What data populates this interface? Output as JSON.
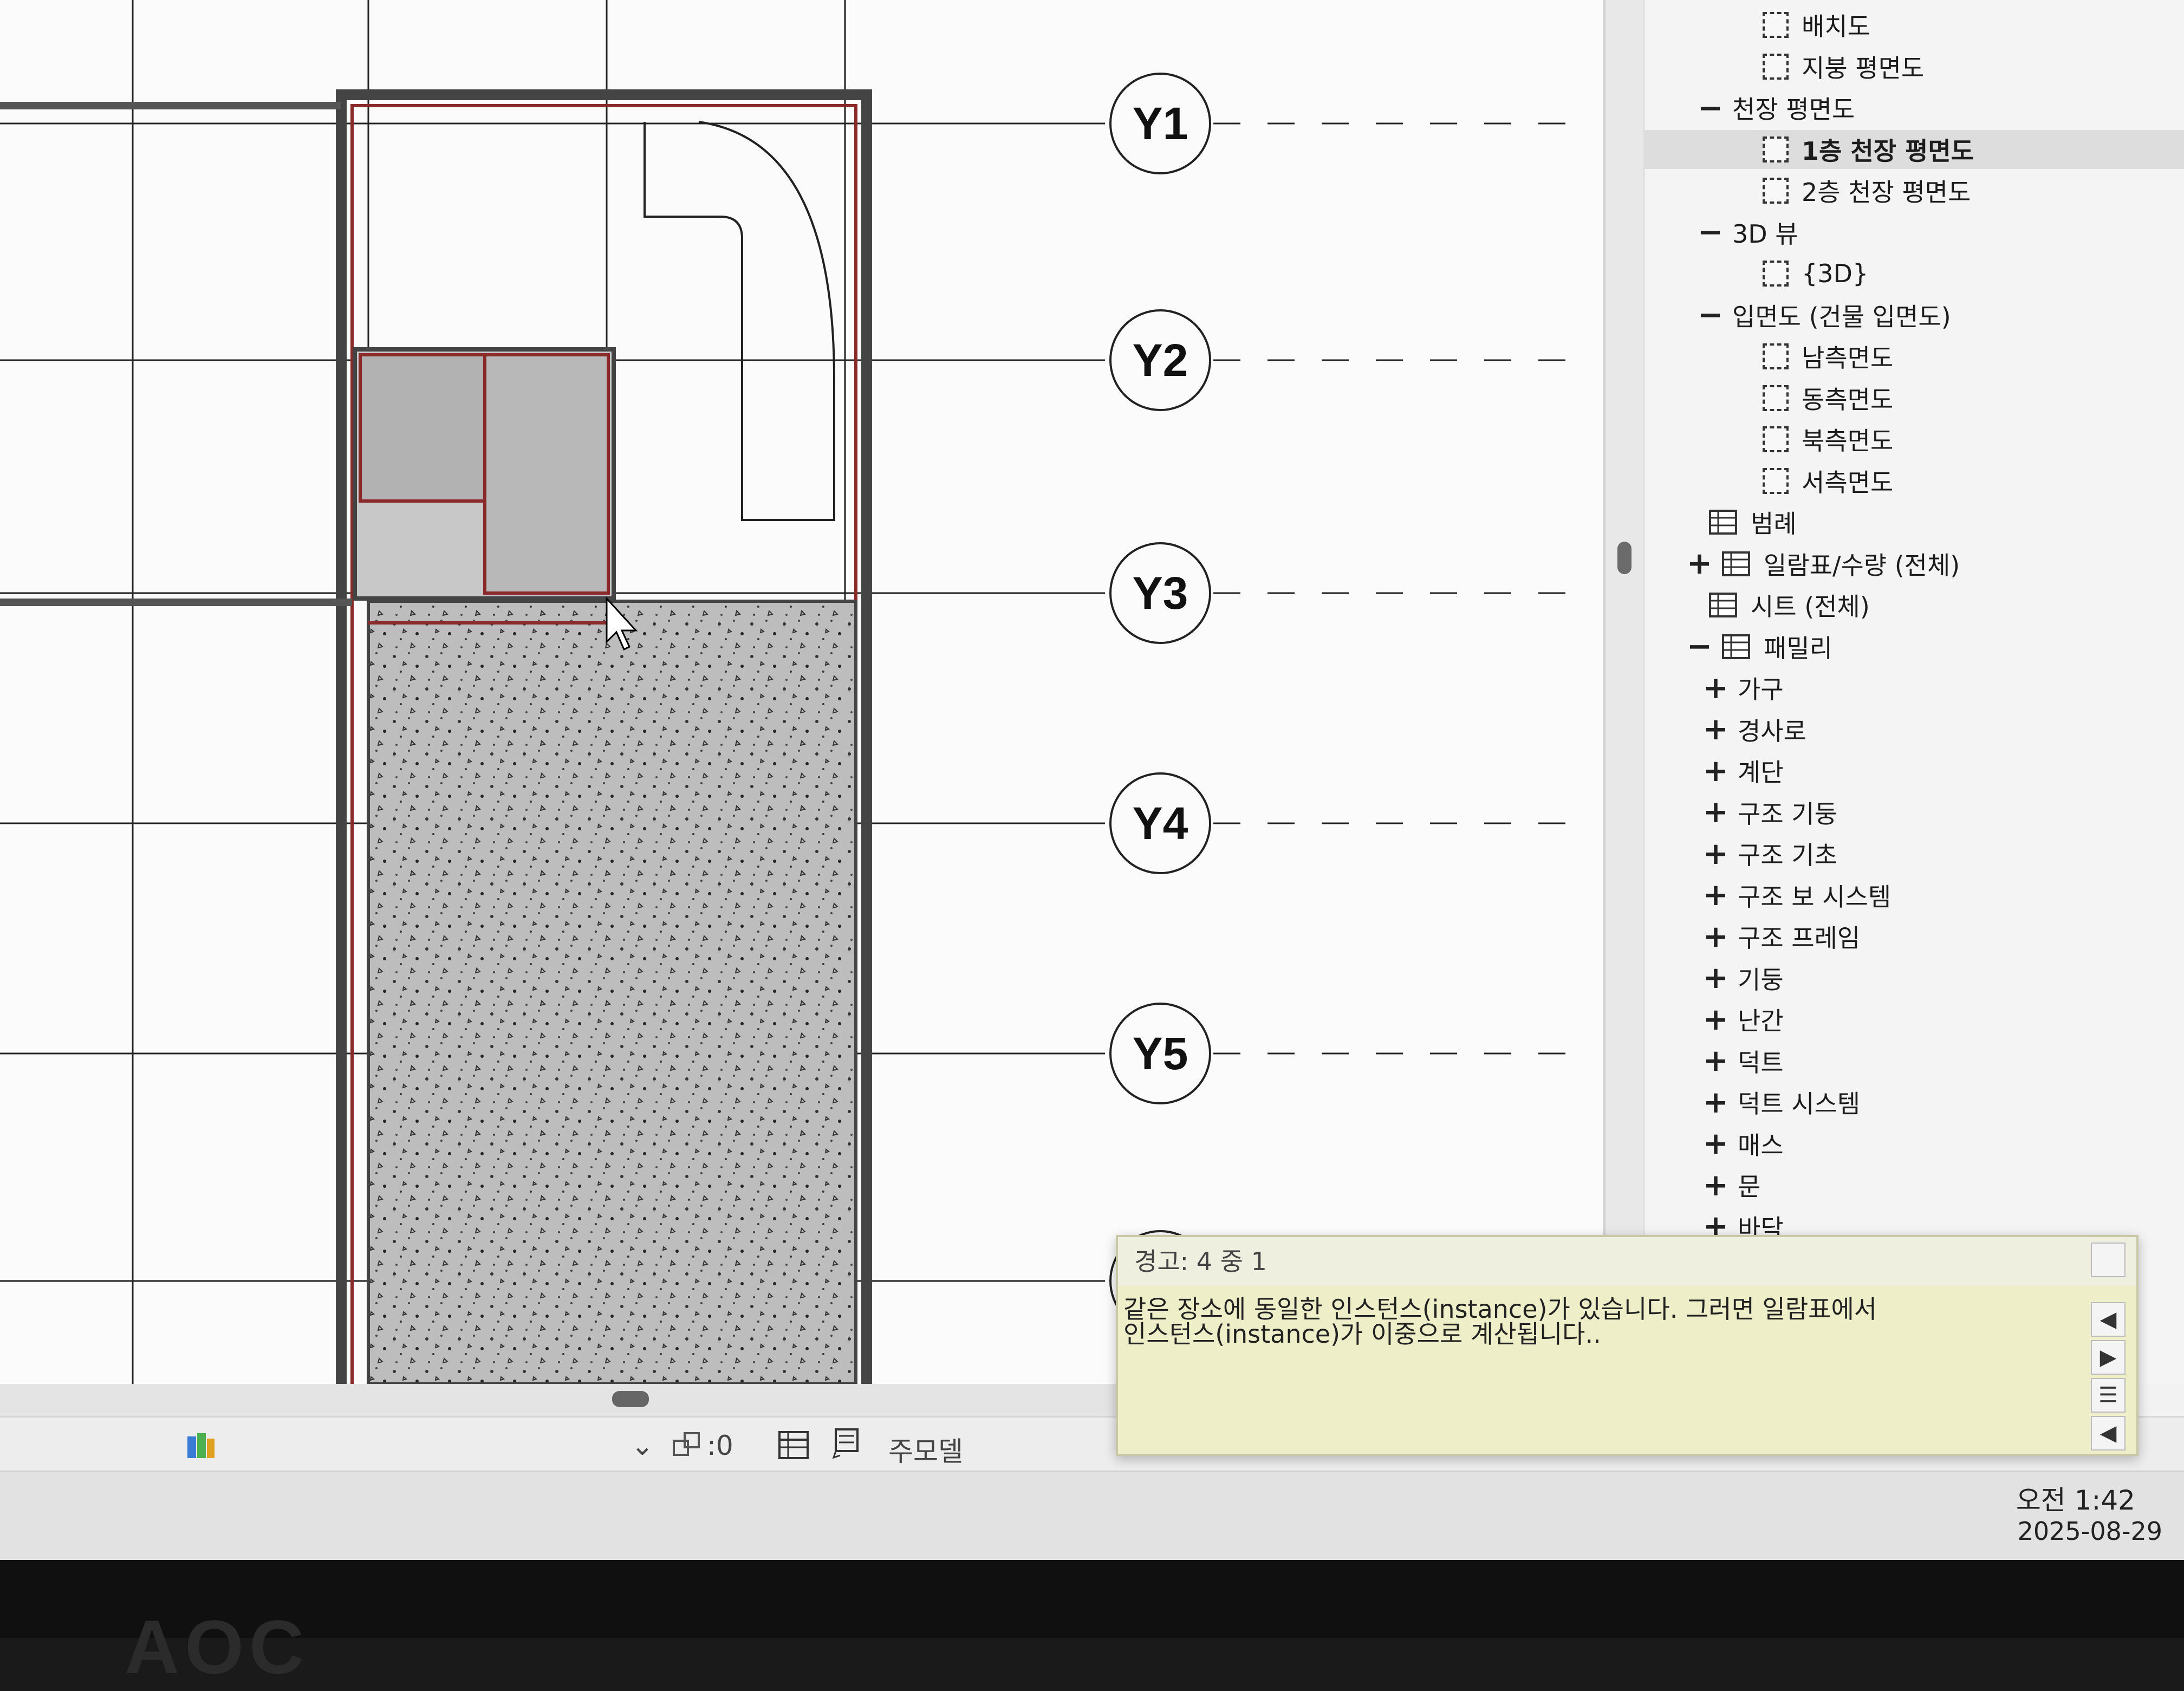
{
  "canvas": {
    "grid_labels": [
      "Y1",
      "Y2",
      "Y3",
      "Y4",
      "Y5"
    ]
  },
  "browser": {
    "items": [
      {
        "label": "배치도",
        "type": "view"
      },
      {
        "label": "지붕 평면도",
        "type": "view"
      },
      {
        "label": "천장 평면도",
        "type": "group",
        "toggle": "−"
      },
      {
        "label": "1층 천장 평면도",
        "type": "view",
        "selected": true
      },
      {
        "label": "2층 천장 평면도",
        "type": "view"
      },
      {
        "label": "3D 뷰",
        "type": "group",
        "toggle": "−"
      },
      {
        "label": "{3D}",
        "type": "view"
      },
      {
        "label": "입면도 (건물 입면도)",
        "type": "group",
        "toggle": "−"
      },
      {
        "label": "남측면도",
        "type": "view"
      },
      {
        "label": "동측면도",
        "type": "view"
      },
      {
        "label": "북측면도",
        "type": "view"
      },
      {
        "label": "서측면도",
        "type": "view"
      },
      {
        "label": "범례",
        "type": "legend"
      },
      {
        "label": "일람표/수량 (전체)",
        "type": "schedule",
        "toggle": "+"
      },
      {
        "label": "시트 (전체)",
        "type": "sheet"
      },
      {
        "label": "패밀리",
        "type": "family",
        "toggle": "−"
      },
      {
        "label": "가구",
        "type": "family-item",
        "toggle": "+"
      },
      {
        "label": "경사로",
        "type": "family-item",
        "toggle": "+"
      },
      {
        "label": "계단",
        "type": "family-item",
        "toggle": "+"
      },
      {
        "label": "구조 기둥",
        "type": "family-item",
        "toggle": "+"
      },
      {
        "label": "구조 기초",
        "type": "family-item",
        "toggle": "+"
      },
      {
        "label": "구조 보 시스템",
        "type": "family-item",
        "toggle": "+"
      },
      {
        "label": "구조 프레임",
        "type": "family-item",
        "toggle": "+"
      },
      {
        "label": "기둥",
        "type": "family-item",
        "toggle": "+"
      },
      {
        "label": "난간",
        "type": "family-item",
        "toggle": "+"
      },
      {
        "label": "덕트",
        "type": "family-item",
        "toggle": "+"
      },
      {
        "label": "덕트 시스템",
        "type": "family-item",
        "toggle": "+"
      },
      {
        "label": "매스",
        "type": "family-item",
        "toggle": "+"
      },
      {
        "label": "문",
        "type": "family-item",
        "toggle": "+"
      },
      {
        "label": "바닥",
        "type": "family-item",
        "toggle": "+"
      }
    ]
  },
  "warning": {
    "title": "경고: 4 중 1",
    "message_line1": "같은 장소에 동일한 인스턴스(instance)가 있습니다. 그러면 일람표에서",
    "message_line2": "인스턴스(instance)가 이중으로 계산됩니다.."
  },
  "status_bar": {
    "selection_count": ":0",
    "model_label": "주모델"
  },
  "taskbar": {
    "time": "오전 1:42",
    "date": "2025-08-29"
  },
  "monitor": {
    "brand": "AOC"
  },
  "colors": {
    "wall_outline": "#8b2a2a",
    "floor_fill": "#b8b8b8",
    "warning_bg": "#eeeec8"
  }
}
